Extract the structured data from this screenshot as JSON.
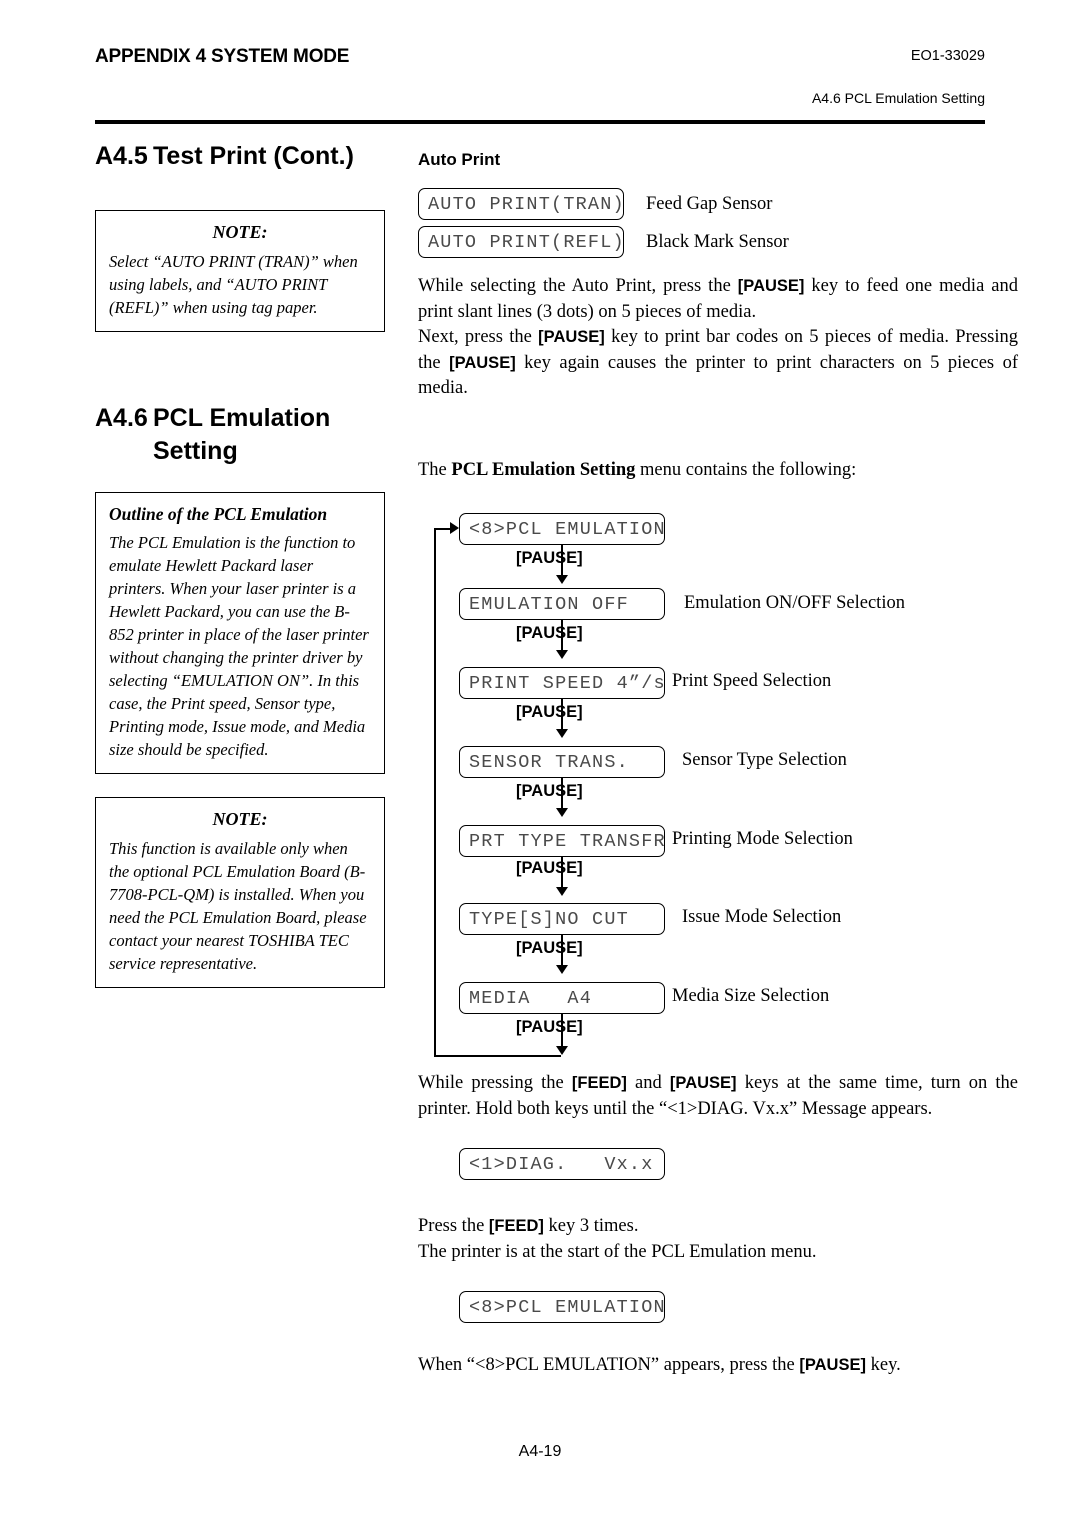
{
  "header": {
    "appendix_title": "APPENDIX 4 SYSTEM MODE",
    "doc_code": "EO1-33029",
    "section_ref": "A4.6 PCL Emulation Setting"
  },
  "left_column": {
    "section_a45": {
      "number": "A4.5",
      "title": "Test Print (Cont.)"
    },
    "note_1": {
      "heading": "NOTE:",
      "body": "Select “AUTO PRINT (TRAN)” when using labels, and “AUTO PRINT (REFL)” when using tag paper."
    },
    "section_a46": {
      "number": "A4.6",
      "title_line1": "PCL Emulation",
      "title_line2": "Setting"
    },
    "outline_box": {
      "heading": "Outline of the PCL Emulation",
      "body": "The PCL Emulation is the function to emulate Hewlett Packard laser printers. When your laser printer is a Hewlett Packard, you can use the B-852 printer in place of the laser printer without changing the printer driver by selecting “EMULATION ON”. In this case, the Print speed, Sensor type, Printing mode, Issue mode, and Media size should be specified."
    },
    "note_2": {
      "heading": "NOTE:",
      "body": "This function is available only when the optional PCL Emulation Board (B-7708-PCL-QM) is installed. When you need the PCL Emulation Board, please contact your nearest TOSHIBA TEC service representative."
    }
  },
  "right_column": {
    "auto_print": {
      "heading": "Auto Print",
      "rows": [
        {
          "display": "AUTO PRINT(TRAN)",
          "label": "Feed Gap Sensor"
        },
        {
          "display": "AUTO PRINT(REFL)",
          "label": "Black Mark Sensor"
        }
      ],
      "paragraph_1": "While selecting the Auto Print, press the [PAUSE] key to feed one media and print slant lines (3 dots) on 5 pieces of media.",
      "paragraph_2": "Next, press the [PAUSE] key to print bar codes on 5 pieces of media. Pressing the [PAUSE] key again causes the printer to print characters on 5 pieces of media.",
      "para1_pre": "While selecting the Auto Print, press the ",
      "para1_key": "[PAUSE]",
      "para1_post": " key to feed one media and print slant lines (3 dots) on 5 pieces of media.",
      "para2_pre": "Next, press the ",
      "para2_key1": "[PAUSE]",
      "para2_mid": " key to print bar codes on 5 pieces of media. Pressing the ",
      "para2_key2": "[PAUSE]",
      "para2_post": " key again causes the printer to print characters on 5 pieces of media."
    },
    "menu_intro": {
      "pre": "The ",
      "bold": "PCL Emulation Setting",
      "post": " menu contains the following:"
    },
    "flow": {
      "key_label": "[PAUSE]",
      "steps": [
        {
          "display": "<8>PCL EMULATION",
          "label": ""
        },
        {
          "display": "EMULATION OFF",
          "label": "Emulation ON/OFF Selection"
        },
        {
          "display": "PRINT SPEED 4”/s",
          "label": "Print Speed Selection"
        },
        {
          "display": "SENSOR TRANS.",
          "label": "Sensor Type Selection"
        },
        {
          "display": "PRT TYPE TRANSFR",
          "label": "Printing Mode Selection"
        },
        {
          "display": "TYPE[S]NO CUT",
          "label": "Issue Mode Selection"
        },
        {
          "display": "MEDIA   A4",
          "label": "Media Size Selection"
        }
      ]
    },
    "power_on": {
      "pre": "While pressing the ",
      "key1": "[FEED]",
      "mid": " and ",
      "key2": "[PAUSE]",
      "post": " keys at the same time, turn on the printer.  Hold both keys until the “<1>DIAG. Vx.x” Message appears.",
      "display": "<1>DIAG.   Vx.x"
    },
    "feed_steps": {
      "line1_pre": "Press the ",
      "line1_key": "[FEED]",
      "line1_post": " key 3 times.",
      "line2": "The printer is at the start of the PCL Emulation menu.",
      "display": "<8>PCL EMULATION",
      "closing_pre": "When “<8>PCL EMULATION” appears, press the ",
      "closing_key": "[PAUSE]",
      "closing_post": " key."
    }
  },
  "footer": {
    "page_number": "A4-19"
  }
}
